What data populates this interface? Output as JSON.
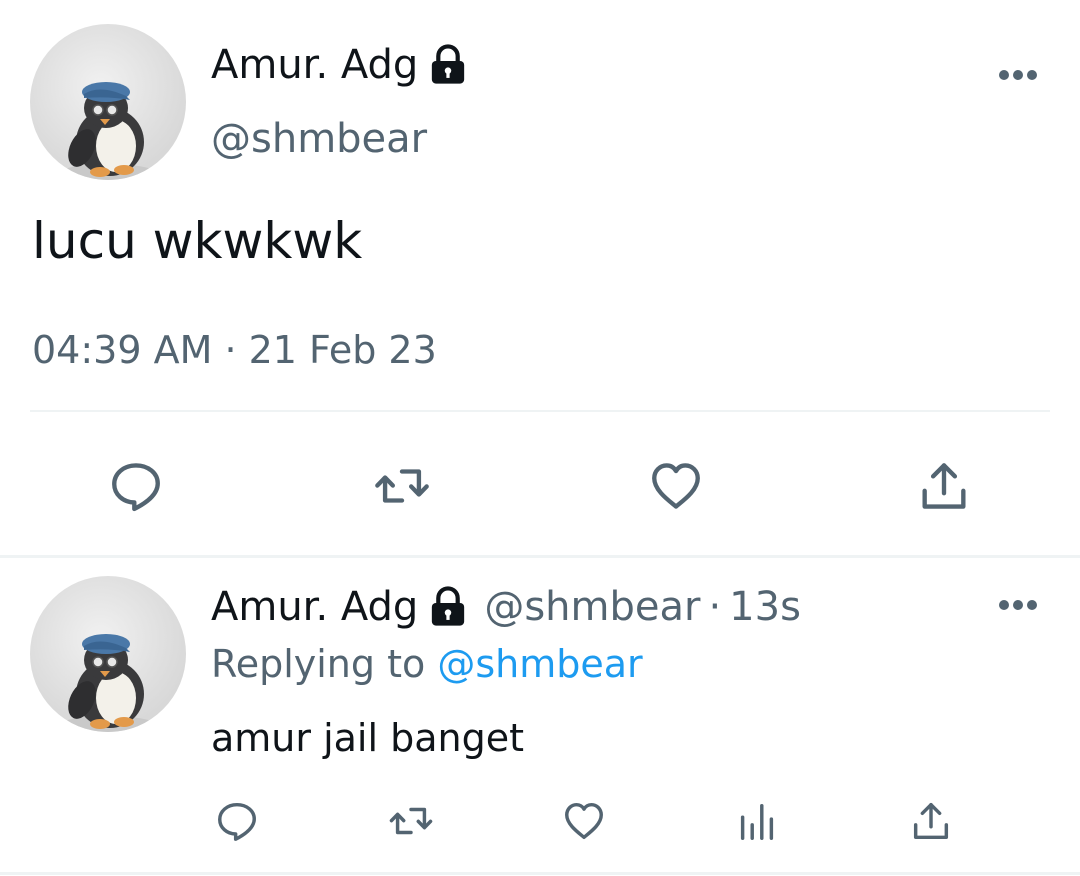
{
  "main_tweet": {
    "display_name": "Amur. Adg",
    "handle": "@shmbear",
    "text": "lucu wkwkwk",
    "timestamp": "04:39 AM · 21 Feb 23"
  },
  "reply": {
    "display_name": "Amur. Adg",
    "handle": "@shmbear",
    "separator": "·",
    "time_ago": "13s",
    "replying_label": "Replying to",
    "replying_to": "@shmbear",
    "text": "amur jail banget"
  },
  "icons": {
    "lock": "lock-icon",
    "more": "more-horizontal-icon",
    "reply": "reply-icon",
    "retweet": "retweet-icon",
    "like": "heart-icon",
    "views": "analytics-icon",
    "share": "share-icon"
  },
  "colors": {
    "primary_text": "#0f1419",
    "secondary_text": "#536471",
    "link": "#1d9bf0",
    "divider": "#eff3f4"
  }
}
